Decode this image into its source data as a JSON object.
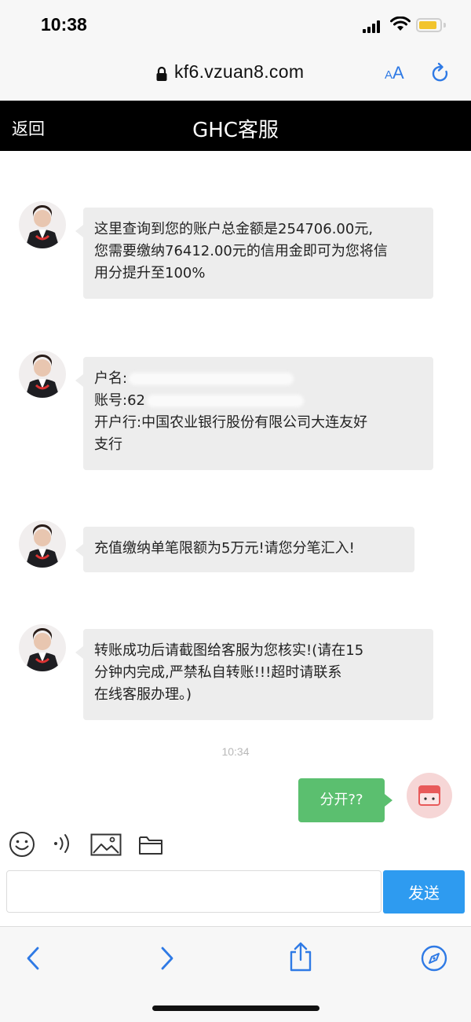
{
  "status_bar": {
    "time": "10:38"
  },
  "browser": {
    "url": "kf6.vzuan8.com",
    "text_size_label": "AA"
  },
  "header": {
    "back_label": "返回",
    "title": "GHC客服"
  },
  "messages": [
    {
      "lines": [
        "这里查询到您的账户总金额是254706.00元,",
        "您需要缴纳76412.00元的信用金即可为您将信",
        "用分提升至100%"
      ]
    },
    {
      "account_name_label": "户名:",
      "account_number_label": "账号:",
      "account_number_prefix": "62",
      "bank_line_1": "开户行:中国农业银行股份有限公司大连友好",
      "bank_line_2": "支行"
    },
    {
      "lines": [
        "充值缴纳单笔限额为5万元!请您分笔汇入!"
      ]
    },
    {
      "lines": [
        "转账成功后请截图给客服为您核实!(请在15",
        "分钟内完成,严禁私自转账!!!超时请联系",
        "在线客服办理。)"
      ]
    }
  ],
  "timestamp": "10:34",
  "my_message": "分开??",
  "composer": {
    "input_value": "",
    "send_label": "发送"
  },
  "toolbar_icons": [
    "emoji-icon",
    "voice-icon",
    "image-icon",
    "folder-icon"
  ],
  "safari_icons": [
    "back-arrow-icon",
    "forward-arrow-icon",
    "share-icon",
    "compass-icon"
  ],
  "colors": {
    "accent": "#2e9bf0",
    "my_bubble": "#5bbf6f",
    "header_bg": "#000000",
    "bubble_bg": "#ededed"
  }
}
